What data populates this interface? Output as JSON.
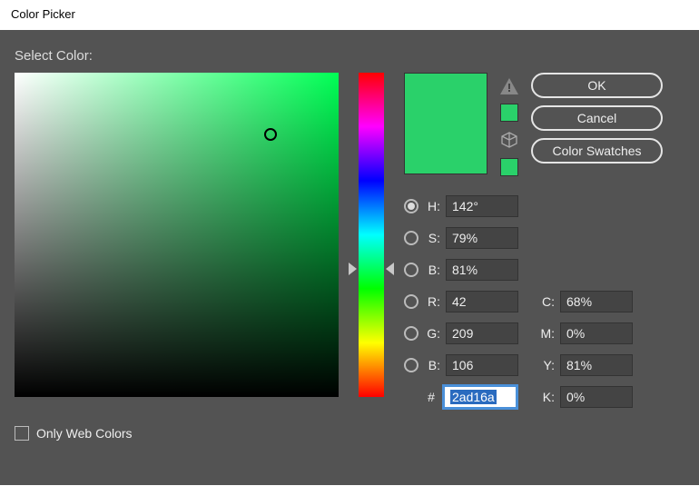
{
  "window": {
    "title": "Color Picker"
  },
  "label": {
    "selectColor": "Select Color:"
  },
  "buttons": {
    "ok": "OK",
    "cancel": "Cancel",
    "swatches": "Color Swatches"
  },
  "hsb": {
    "h_label": "H:",
    "h_value": "142°",
    "s_label": "S:",
    "s_value": "79%",
    "b_label": "B:",
    "b_value": "81%"
  },
  "rgb": {
    "r_label": "R:",
    "r_value": "42",
    "g_label": "G:",
    "g_value": "209",
    "b_label": "B:",
    "b_value": "106"
  },
  "hex": {
    "hash": "#",
    "value": "2ad16a"
  },
  "cmyk": {
    "c_label": "C:",
    "c_value": "68%",
    "m_label": "M:",
    "m_value": "0%",
    "y_label": "Y:",
    "y_value": "81%",
    "k_label": "K:",
    "k_value": "0%"
  },
  "webOnly": {
    "label": "Only Web Colors"
  },
  "colors": {
    "new": "#2ad16a",
    "current": "#2ad16a",
    "warnSwatch": "#2ad16a",
    "cubeSwatch": "#2ad16a"
  },
  "cursor": {
    "satPct": 79,
    "briPct": 81,
    "huePct": 60.6
  }
}
